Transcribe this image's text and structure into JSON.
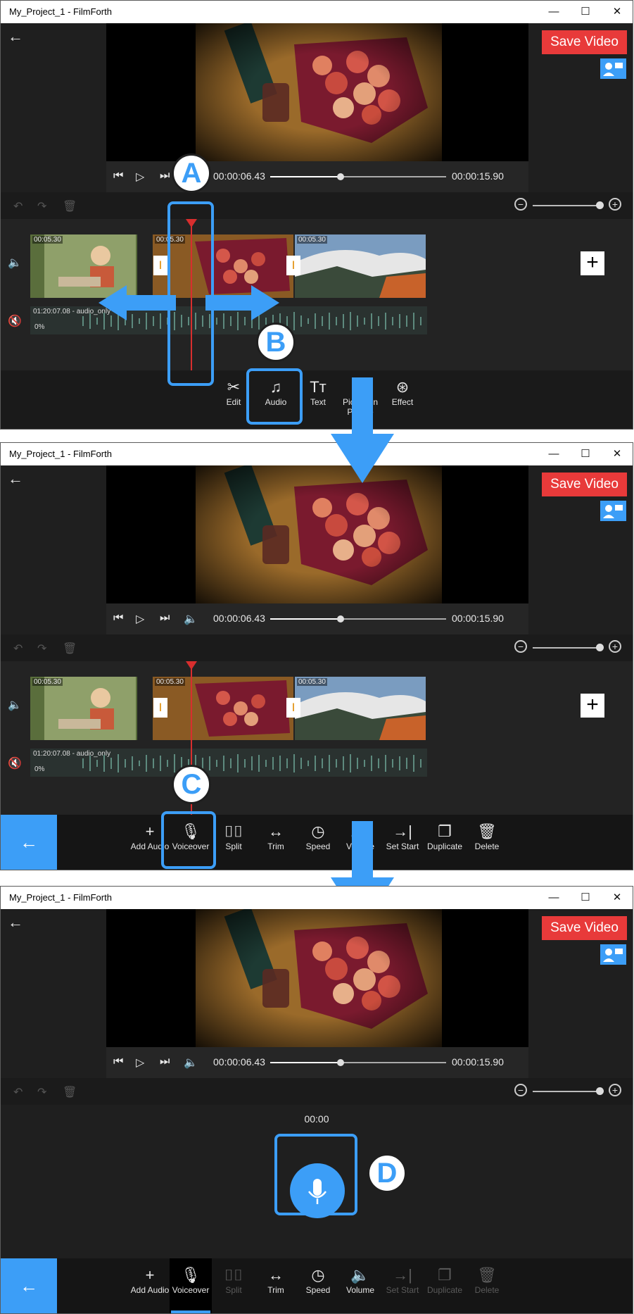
{
  "window": {
    "title": "My_Project_1 - FilmForth",
    "minimize": "—",
    "maximize": "☐",
    "close": "✕"
  },
  "header": {
    "save_label": "Save Video",
    "back_icon": "arrow-left-icon"
  },
  "player": {
    "current_time": "00:00:06.43",
    "total_time": "00:00:15.90",
    "progress": 0.4
  },
  "timeline": {
    "clips": [
      {
        "duration": "00:05.30"
      },
      {
        "duration": "00:05.30"
      },
      {
        "duration": "00:05.30"
      }
    ],
    "audio": {
      "label": "01:20:07.08 - audio_only",
      "volume": "0%"
    },
    "zoom_level": 0.95
  },
  "main_toolbar": {
    "items": [
      {
        "label": "Edit",
        "icon": "scissors-icon"
      },
      {
        "label": "Audio",
        "icon": "music-note-icon"
      },
      {
        "label": "Text",
        "icon": "text-icon"
      },
      {
        "label": "Picture in Picture",
        "icon": "pip-icon"
      },
      {
        "label": "Effect",
        "icon": "effect-icon"
      }
    ]
  },
  "audio_toolbar": {
    "items": [
      {
        "label": "Add Audio",
        "icon": "plus-icon"
      },
      {
        "label": "Voiceover",
        "icon": "microphone-icon"
      },
      {
        "label": "Split",
        "icon": "split-icon"
      },
      {
        "label": "Trim",
        "icon": "trim-icon"
      },
      {
        "label": "Speed",
        "icon": "speed-icon"
      },
      {
        "label": "Volume",
        "icon": "volume-icon"
      },
      {
        "label": "Set Start",
        "icon": "set-start-icon"
      },
      {
        "label": "Duplicate",
        "icon": "duplicate-icon"
      },
      {
        "label": "Delete",
        "icon": "trash-icon"
      }
    ]
  },
  "voiceover": {
    "timer": "00:00"
  },
  "badges": {
    "a": "A",
    "b": "B",
    "c": "C",
    "d": "D"
  },
  "colors": {
    "accent": "#3c9ef7",
    "save": "#e83a3a",
    "playhead": "#d82e2e",
    "background": "#1f1f1f"
  }
}
